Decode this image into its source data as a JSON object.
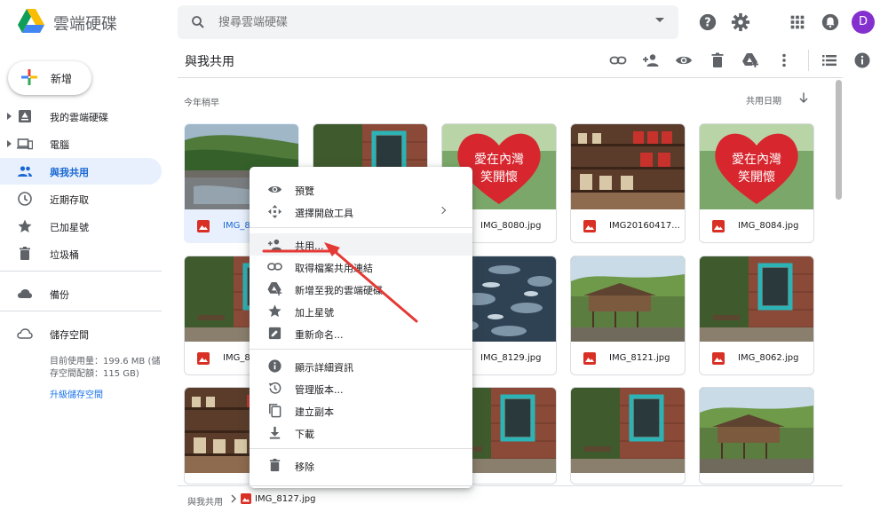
{
  "app": {
    "title": "雲端硬碟"
  },
  "search": {
    "placeholder": "搜尋雲端硬碟"
  },
  "header_icons": [
    "help-icon",
    "settings-icon",
    "apps-grid-icon",
    "notifications-icon"
  ],
  "account": {
    "initial": "D",
    "color": "#8430ce"
  },
  "sidebar": {
    "new_label": "新增",
    "items": [
      {
        "label": "我的雲端硬碟",
        "icon": "my-drive-icon",
        "expandable": true,
        "active": false
      },
      {
        "label": "電腦",
        "icon": "computers-icon",
        "expandable": true,
        "active": false
      },
      {
        "label": "與我共用",
        "icon": "shared-with-me-icon",
        "expandable": false,
        "active": true
      },
      {
        "label": "近期存取",
        "icon": "recent-icon",
        "expandable": false,
        "active": false
      },
      {
        "label": "已加星號",
        "icon": "star-icon",
        "expandable": false,
        "active": false
      },
      {
        "label": "垃圾桶",
        "icon": "trash-icon",
        "expandable": false,
        "active": false
      }
    ],
    "backup_label": "備份",
    "storage_label": "儲存空間",
    "storage_usage": "目前使用量：199.6 MB (儲存空間配額：115 GB)",
    "upgrade_label": "升級儲存空間"
  },
  "main": {
    "title": "與我共用",
    "toolbar_icons": [
      "get-link-icon",
      "share-icon",
      "preview-icon",
      "delete-icon",
      "add-to-drive-icon",
      "more-vert-icon",
      "list-view-icon",
      "details-icon"
    ],
    "section_label": "今年稍早",
    "sort_label": "共用日期"
  },
  "files": [
    {
      "name": "IMG_8127.jpg",
      "shown": "IMG_81",
      "selected": true,
      "thumb": "river-valley"
    },
    {
      "name": "",
      "shown": "",
      "selected": false,
      "thumb": "blue-window"
    },
    {
      "name": "IMG_8080.jpg",
      "shown": "IMG_8080.jpg",
      "selected": false,
      "thumb": "heart-sign"
    },
    {
      "name": "IMG20160417...",
      "shown": "IMG20160417...",
      "selected": false,
      "thumb": "shop-shelves"
    },
    {
      "name": "IMG_8084.jpg",
      "shown": "IMG_8084.jpg",
      "selected": false,
      "thumb": "heart-sign"
    },
    {
      "name": "IMG_8",
      "shown": "IMG_8",
      "selected": false,
      "thumb": "blue-window"
    },
    {
      "name": "",
      "shown": "",
      "selected": false,
      "thumb": "hidden"
    },
    {
      "name": "IMG_8129.jpg",
      "shown": "IMG_8129.jpg",
      "selected": false,
      "thumb": "river-water"
    },
    {
      "name": "IMG_8121.jpg",
      "shown": "IMG_8121.jpg",
      "selected": false,
      "thumb": "wooden-hut"
    },
    {
      "name": "IMG_8062.jpg",
      "shown": "IMG_8062.jpg",
      "selected": false,
      "thumb": "blue-window"
    },
    {
      "name": "",
      "shown": "",
      "selected": false,
      "thumb": "shop-shelves"
    },
    {
      "name": "",
      "shown": "",
      "selected": false,
      "thumb": "hidden"
    },
    {
      "name": "",
      "shown": "",
      "selected": false,
      "thumb": "blue-window"
    },
    {
      "name": "",
      "shown": "",
      "selected": false,
      "thumb": "blue-window"
    },
    {
      "name": "",
      "shown": "",
      "selected": false,
      "thumb": "wooden-hut"
    }
  ],
  "context_menu": [
    {
      "label": "預覽",
      "icon": "preview-icon"
    },
    {
      "label": "選擇開啟工具",
      "icon": "open-with-icon",
      "submenu": true
    },
    {
      "label": "共用...",
      "icon": "share-icon",
      "highlighted": true
    },
    {
      "label": "取得檔案共用連結",
      "icon": "get-link-icon"
    },
    {
      "label": "新增至我的雲端硬碟",
      "icon": "add-to-drive-icon"
    },
    {
      "label": "加上星號",
      "icon": "star-icon"
    },
    {
      "label": "重新命名...",
      "icon": "rename-icon"
    },
    {
      "label": "顯示詳細資訊",
      "icon": "info-icon"
    },
    {
      "label": "管理版本...",
      "icon": "manage-versions-icon"
    },
    {
      "label": "建立副本",
      "icon": "copy-icon"
    },
    {
      "label": "下載",
      "icon": "download-icon"
    },
    {
      "label": "移除",
      "icon": "remove-icon"
    }
  ],
  "breadcrumb": {
    "parent": "與我共用",
    "current": "IMG_8127.jpg"
  },
  "colors": {
    "accent": "#1a73e8",
    "active_bg": "#e8f0fe",
    "annotation": "#e53935",
    "image_icon": "#d93025"
  }
}
